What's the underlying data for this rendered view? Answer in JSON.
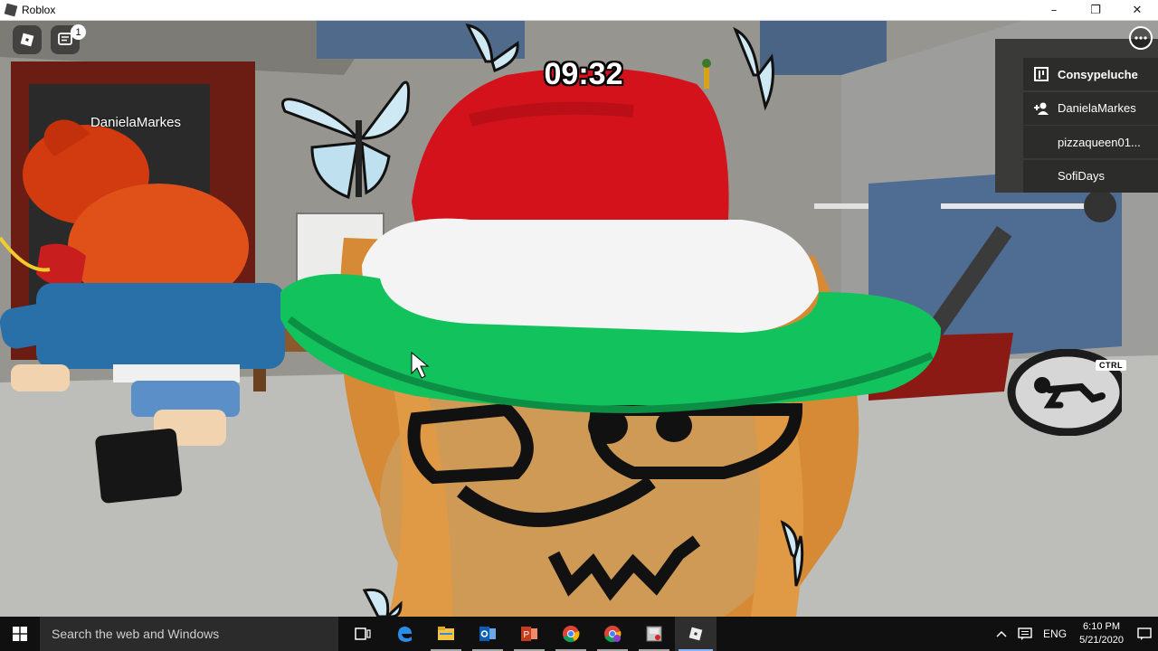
{
  "window": {
    "title": "Roblox",
    "controls": [
      "–",
      "❐",
      "✕"
    ]
  },
  "hud": {
    "timer": "09:32",
    "chat_badge": "1",
    "ctrl_label": "CTRL"
  },
  "nametag": "DanielaMarkes",
  "player_list": [
    {
      "name": "Consypeluche",
      "icon": "leaderboard-icon"
    },
    {
      "name": "DanielaMarkes",
      "icon": "friend-icon"
    },
    {
      "name": "pizzaqueen01...",
      "icon": ""
    },
    {
      "name": "SofiDays",
      "icon": ""
    }
  ],
  "taskbar": {
    "search_placeholder": "Search the web and Windows",
    "icons": [
      "task-view-icon",
      "edge-icon",
      "file-explorer-icon",
      "outlook-icon",
      "powerpoint-icon",
      "chrome-icon",
      "chrome-profile-icon",
      "paint-icon",
      "roblox-icon"
    ],
    "language": "ENG",
    "time": "6:10 PM",
    "date": "5/21/2020"
  },
  "colors": {
    "hat_red": "#d3121b",
    "hat_band": "#f4f4f4",
    "hat_brim": "#12c25c",
    "hair": "#d68a35",
    "skin": "#cf9a55",
    "taskbar": "#101010",
    "search_box": "#2b2b2b"
  }
}
